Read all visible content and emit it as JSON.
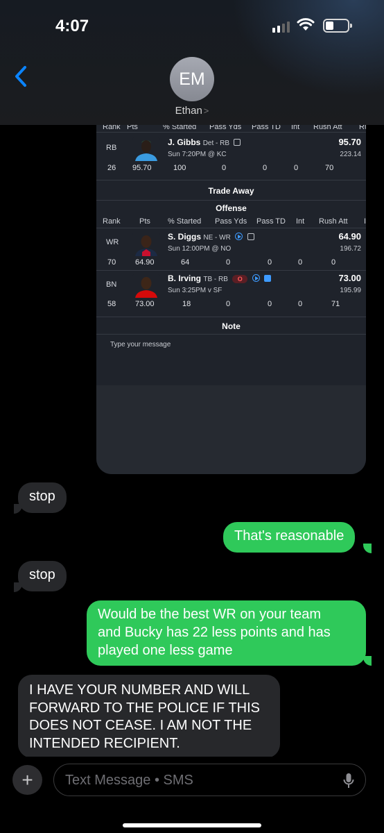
{
  "status_bar": {
    "time": "4:07",
    "battery_pct": 0.3,
    "signal_bars": 2
  },
  "header": {
    "back_icon": "chevron-left-icon",
    "avatar_initials": "EM",
    "contact_name": "Ethan",
    "contact_chevron": ">"
  },
  "attachment": {
    "receive_columns": [
      "Rank",
      "Pts",
      "% Started",
      "Pass Yds",
      "Pass TD",
      "Int",
      "Rush Att",
      "Ru"
    ],
    "receive_player": {
      "pos": "RB",
      "name": "J. Gibbs",
      "team_pos": "Det - RB",
      "game": "Sun 7:20PM @ KC",
      "pts": "95.70",
      "proj": "223.14",
      "stats": [
        "26",
        "95.70",
        "100",
        "0",
        "0",
        "0",
        "70"
      ]
    },
    "trade_away_title": "Trade Away",
    "offense_title": "Offense",
    "away_columns": [
      "Rank",
      "Pts",
      "% Started",
      "Pass Yds",
      "Pass TD",
      "Int",
      "Rush Att",
      "I"
    ],
    "away_players": [
      {
        "pos": "WR",
        "name": "S. Diggs",
        "team_pos": "NE - WR",
        "game": "Sun 12:00PM @ NO",
        "pts": "64.90",
        "proj": "196.72",
        "stats": [
          "70",
          "64.90",
          "64",
          "0",
          "0",
          "0",
          "0"
        ]
      },
      {
        "pos": "BN",
        "name": "B. Irving",
        "team_pos": "TB - RB",
        "game": "Sun 3:25PM v SF",
        "pts": "73.00",
        "proj": "195.99",
        "badge": "O",
        "stats": [
          "58",
          "73.00",
          "18",
          "0",
          "0",
          "0",
          "71"
        ]
      }
    ],
    "note_title": "Note",
    "note_placeholder": "Type your message"
  },
  "messages": [
    {
      "dir": "in",
      "text": "stop"
    },
    {
      "dir": "out",
      "text": "That's reasonable"
    },
    {
      "dir": "in",
      "text": "stop"
    },
    {
      "dir": "out",
      "lines": [
        "Would be the best WR on your team",
        "and Bucky has 22 less points and has",
        "played one less game"
      ]
    },
    {
      "dir": "in",
      "lines": [
        "I HAVE YOUR NUMBER AND WILL",
        "FORWARD TO THE POLICE IF THIS",
        "DOES NOT CEASE. I AM NOT THE",
        "INTENDED RECIPIENT."
      ]
    }
  ],
  "composer": {
    "plus_label": "+",
    "placeholder": "Text Message • SMS",
    "mic_icon": "microphone-icon"
  },
  "colors": {
    "green_bubble": "#2fc95a",
    "gray_bubble": "#27282b",
    "ios_blue": "#0a84ff"
  }
}
